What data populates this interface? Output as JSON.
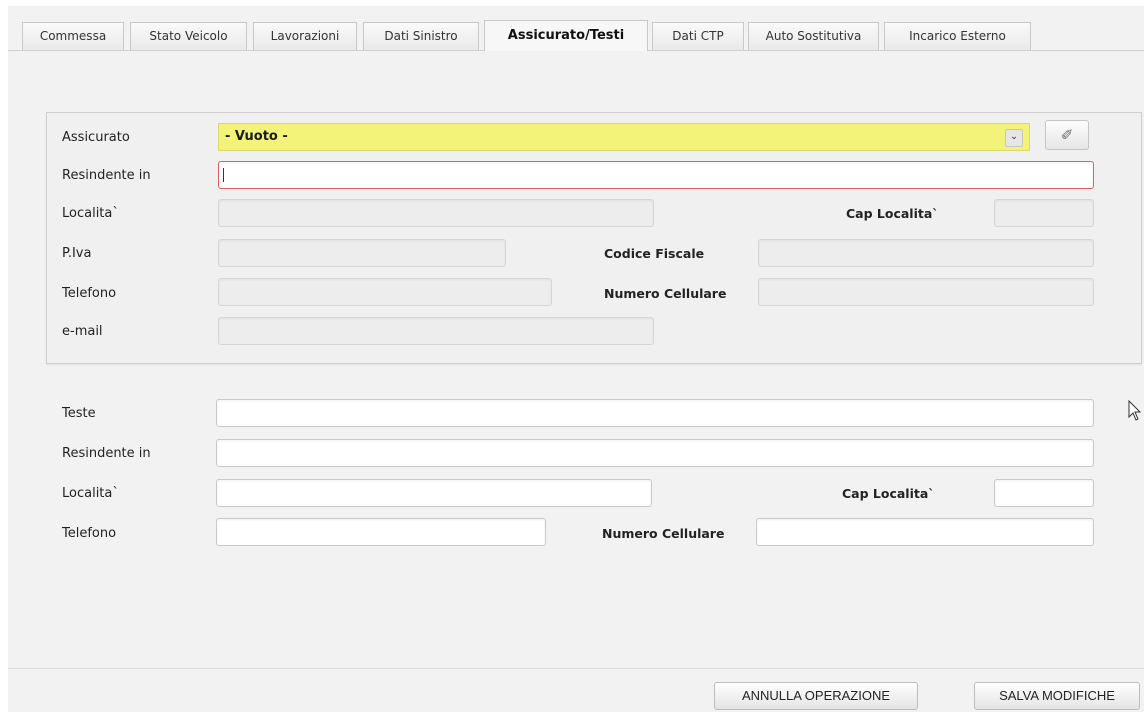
{
  "tabs": [
    {
      "label": "Commessa"
    },
    {
      "label": "Stato Veicolo"
    },
    {
      "label": "Lavorazioni"
    },
    {
      "label": "Dati Sinistro"
    },
    {
      "label": "Assicurato/Testi",
      "active": true
    },
    {
      "label": "Dati CTP"
    },
    {
      "label": "Auto Sostitutiva"
    },
    {
      "label": "Incarico Esterno"
    }
  ],
  "assicurato": {
    "label": "Assicurato",
    "select_value": "- Vuoto -",
    "resident_label": "Resindente in",
    "resident_value": "",
    "localita_label": "Localita`",
    "cap_label": "Cap Localita`",
    "piva_label": "P.Iva",
    "cf_label": "Codice Fiscale",
    "telefono_label": "Telefono",
    "cellulare_label": "Numero Cellulare",
    "email_label": "e-mail"
  },
  "teste": {
    "label": "Teste",
    "resident_label": "Resindente in",
    "localita_label": "Localita`",
    "cap_label": "Cap Localita`",
    "telefono_label": "Telefono",
    "cellulare_label": "Numero Cellulare"
  },
  "footer": {
    "cancel_label": "ANNULLA OPERAZIONE",
    "save_label": "SALVA MODIFICHE"
  },
  "icons": {
    "dropdown": "chevron-down-icon",
    "edit": "edit-icon",
    "cursor": "mouse-pointer-icon"
  },
  "colors": {
    "select_bg": "#f3f37a",
    "error_border": "#e06060"
  }
}
